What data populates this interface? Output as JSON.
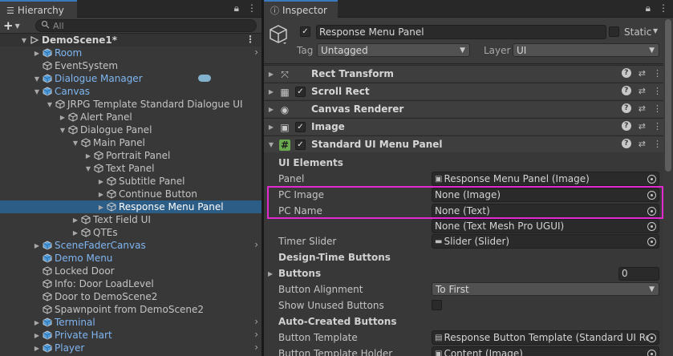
{
  "hierarchy": {
    "tab_label": "Hierarchy",
    "search_placeholder": "All",
    "plus_label": "+",
    "rows": [
      {
        "label": "DemoScene1*",
        "kind": "scene",
        "menu": "⋮"
      },
      {
        "label": "Room",
        "kind": "prefab",
        "arrow": "›"
      },
      {
        "label": "EventSystem",
        "kind": "object"
      },
      {
        "label": "Dialogue Manager",
        "kind": "prefab"
      },
      {
        "label": "Canvas",
        "kind": "prefab"
      },
      {
        "label": "JRPG Template Standard Dialogue UI",
        "kind": "object"
      },
      {
        "label": "Alert Panel",
        "kind": "object"
      },
      {
        "label": "Dialogue Panel",
        "kind": "object"
      },
      {
        "label": "Main Panel",
        "kind": "object"
      },
      {
        "label": "Portrait Panel",
        "kind": "object"
      },
      {
        "label": "Text Panel",
        "kind": "object"
      },
      {
        "label": "Subtitle Panel",
        "kind": "object"
      },
      {
        "label": "Continue Button",
        "kind": "object"
      },
      {
        "label": "Response Menu Panel",
        "kind": "selected"
      },
      {
        "label": "Text Field UI",
        "kind": "object"
      },
      {
        "label": "QTEs",
        "kind": "object"
      },
      {
        "label": "SceneFaderCanvas",
        "kind": "prefab",
        "arrow": "›"
      },
      {
        "label": "Demo Menu",
        "kind": "prefab"
      },
      {
        "label": "Locked Door",
        "kind": "object"
      },
      {
        "label": "Info: Door LoadLevel",
        "kind": "object"
      },
      {
        "label": "Door to DemoScene2",
        "kind": "object"
      },
      {
        "label": "Spawnpoint from DemoScene2",
        "kind": "object"
      },
      {
        "label": "Terminal",
        "kind": "prefab",
        "arrow": "›"
      },
      {
        "label": "Private Hart",
        "kind": "prefab",
        "arrow": "›"
      },
      {
        "label": "Player",
        "kind": "prefab",
        "arrow": "›"
      }
    ]
  },
  "inspector": {
    "tab_label": "Inspector",
    "object_name": "Response Menu Panel",
    "static_label": "Static",
    "tag_label": "Tag",
    "tag_value": "Untagged",
    "layer_label": "Layer",
    "layer_value": "UI",
    "components": [
      {
        "title": "Rect Transform",
        "icon": "rect-transform-icon",
        "checkbox": false,
        "expanded": false
      },
      {
        "title": "Scroll Rect",
        "icon": "scroll-rect-icon",
        "checkbox": true,
        "expanded": false
      },
      {
        "title": "Canvas Renderer",
        "icon": "eye-icon",
        "checkbox": false,
        "expanded": false
      },
      {
        "title": "Image",
        "icon": "image-icon",
        "checkbox": true,
        "expanded": false
      },
      {
        "title": "Standard UI Menu Panel",
        "icon": "script-icon",
        "checkbox": true,
        "expanded": true
      }
    ],
    "props": {
      "ui_elements": "UI Elements",
      "panel_label": "Panel",
      "panel_value": "Response Menu Panel (Image)",
      "pc_image_label": "PC Image",
      "pc_image_value": "None (Image)",
      "pc_name_label": "PC Name",
      "pc_name_value": "None (Text)",
      "pc_name_tmp_value": "None (Text Mesh Pro UGUI)",
      "timer_slider_label": "Timer Slider",
      "timer_slider_value": "Slider (Slider)",
      "design_time_buttons": "Design-Time Buttons",
      "buttons_label": "Buttons",
      "buttons_count": "0",
      "button_alignment_label": "Button Alignment",
      "button_alignment_value": "To First",
      "show_unused_label": "Show Unused Buttons",
      "auto_created_buttons": "Auto-Created Buttons",
      "button_template_label": "Button Template",
      "button_template_value": "Response Button Template (Standard UI Res",
      "button_template_holder_label": "Button Template Holder",
      "button_template_holder_value": "Content (Image)"
    }
  },
  "colors": {
    "selection": "#2c5d87",
    "prefab_text": "#7fb6f2",
    "highlight_box": "#e12bd0",
    "tab_accent": "#3a79bb"
  }
}
